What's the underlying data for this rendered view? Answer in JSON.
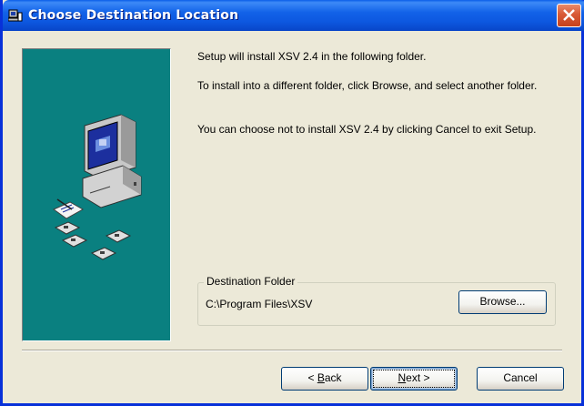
{
  "window": {
    "title": "Choose Destination Location",
    "icons": {
      "app": "setup-app-icon",
      "close": "close-icon"
    }
  },
  "body": {
    "line1": "Setup will install XSV 2.4 in the following folder.",
    "line2": "To install into a different folder, click Browse, and select another folder.",
    "line3": "You can choose not to install XSV 2.4 by clicking Cancel to exit Setup."
  },
  "banner": {
    "illustration": "computer-with-disks-icon"
  },
  "destination": {
    "group_label": "Destination Folder",
    "path": "C:\\Program Files\\XSV",
    "browse_label": "Browse..."
  },
  "buttons": {
    "back_prefix": "< ",
    "back_hot": "B",
    "back_rest": "ack",
    "next_hot": "N",
    "next_rest": "ext >",
    "cancel": "Cancel"
  },
  "colors": {
    "titlebar": "#0a5ee8",
    "banner": "#0a8080",
    "face": "#ece9d8"
  }
}
